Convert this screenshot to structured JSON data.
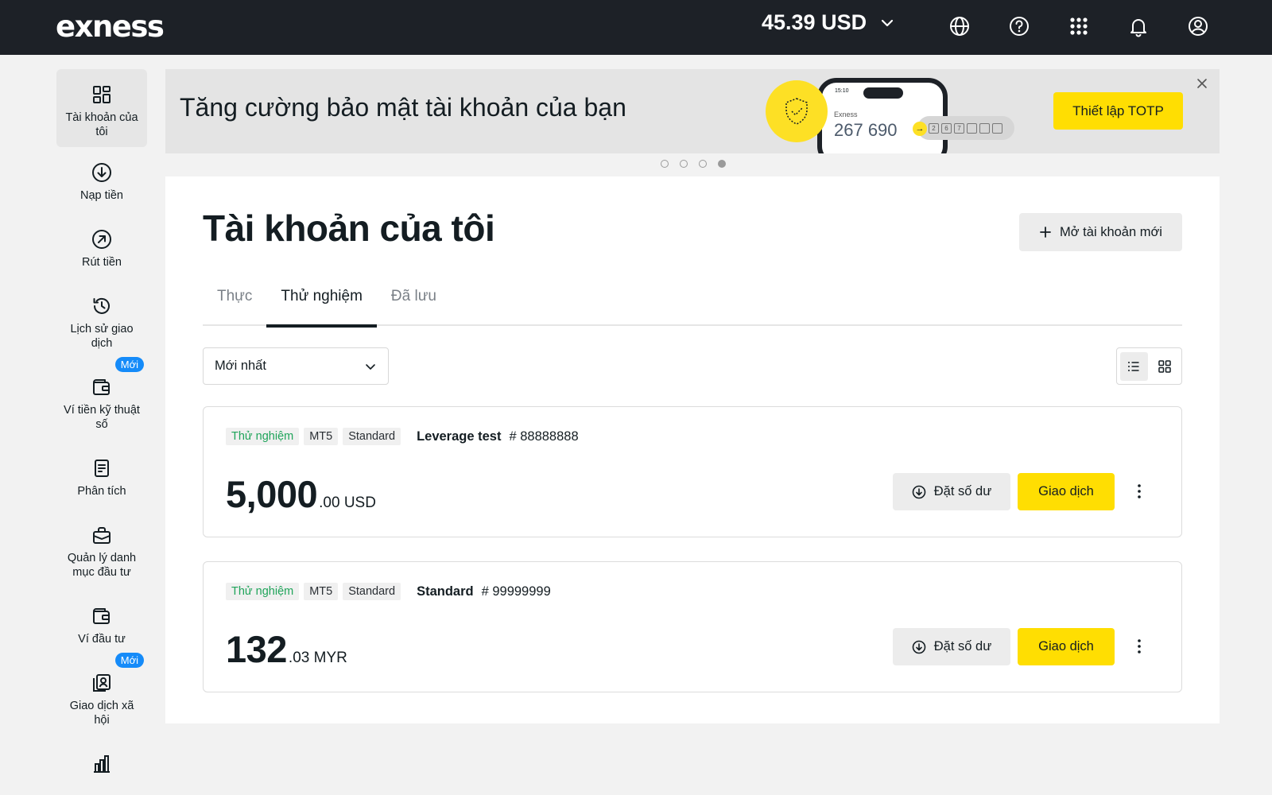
{
  "header": {
    "logo": "exness",
    "balance": "45.39 USD",
    "icons": [
      "globe-icon",
      "help-icon",
      "apps-grid-icon",
      "bell-icon",
      "user-icon"
    ]
  },
  "sidebar": {
    "items": [
      {
        "label": "Tài khoản của tôi",
        "icon": "accounts-grid-icon",
        "active": true
      },
      {
        "label": "Nạp tiền",
        "icon": "deposit-icon"
      },
      {
        "label": "Rút tiền",
        "icon": "withdraw-icon"
      },
      {
        "label": "Lịch sử giao dịch",
        "icon": "history-icon"
      },
      {
        "label": "Ví tiền kỹ thuật số",
        "icon": "crypto-wallet-icon",
        "badge": "Mới"
      },
      {
        "label": "Phân tích",
        "icon": "analytics-icon"
      },
      {
        "label": "Quản lý danh mục đầu tư",
        "icon": "portfolio-icon"
      },
      {
        "label": "Ví đầu tư",
        "icon": "investment-wallet-icon"
      },
      {
        "label": "Giao dịch xã hội",
        "icon": "social-trading-icon",
        "badge": "Mới"
      },
      {
        "label": "",
        "icon": "bar-chart-icon"
      }
    ]
  },
  "banner": {
    "title": "Tăng cường bảo mật tài khoản của bạn",
    "phone_time": "15:10",
    "phone_brand": "Exness",
    "phone_code": "267 690",
    "otp_digits": [
      "2",
      "6",
      "7",
      "",
      "",
      ""
    ],
    "cta": "Thiết lập TOTP",
    "dots": 4,
    "active_dot": 3
  },
  "main": {
    "title": "Tài khoản của tôi",
    "new_account_button": "Mở tài khoản mới",
    "tabs": [
      {
        "label": "Thực",
        "active": false
      },
      {
        "label": "Thử nghiệm",
        "active": true
      },
      {
        "label": "Đã lưu",
        "active": false
      }
    ],
    "sort": {
      "selected": "Mới nhất"
    },
    "view": "list"
  },
  "accounts": [
    {
      "tags": [
        "Thử nghiệm",
        "MT5",
        "Standard"
      ],
      "name": "Leverage test",
      "number": "# 88888888",
      "amount_whole": "5,000",
      "amount_fraction": ".00 USD",
      "set_balance": "Đặt số dư",
      "trade": "Giao dịch"
    },
    {
      "tags": [
        "Thử nghiệm",
        "MT5",
        "Standard"
      ],
      "name": "Standard",
      "number": "# 99999999",
      "amount_whole": "132",
      "amount_fraction": ".03 MYR",
      "set_balance": "Đặt số dư",
      "trade": "Giao dịch"
    }
  ],
  "colors": {
    "topbar": "#1d2127",
    "accent_yellow": "#ffde02",
    "badge_blue": "#158bf9",
    "demo_green": "#1fa45a"
  }
}
